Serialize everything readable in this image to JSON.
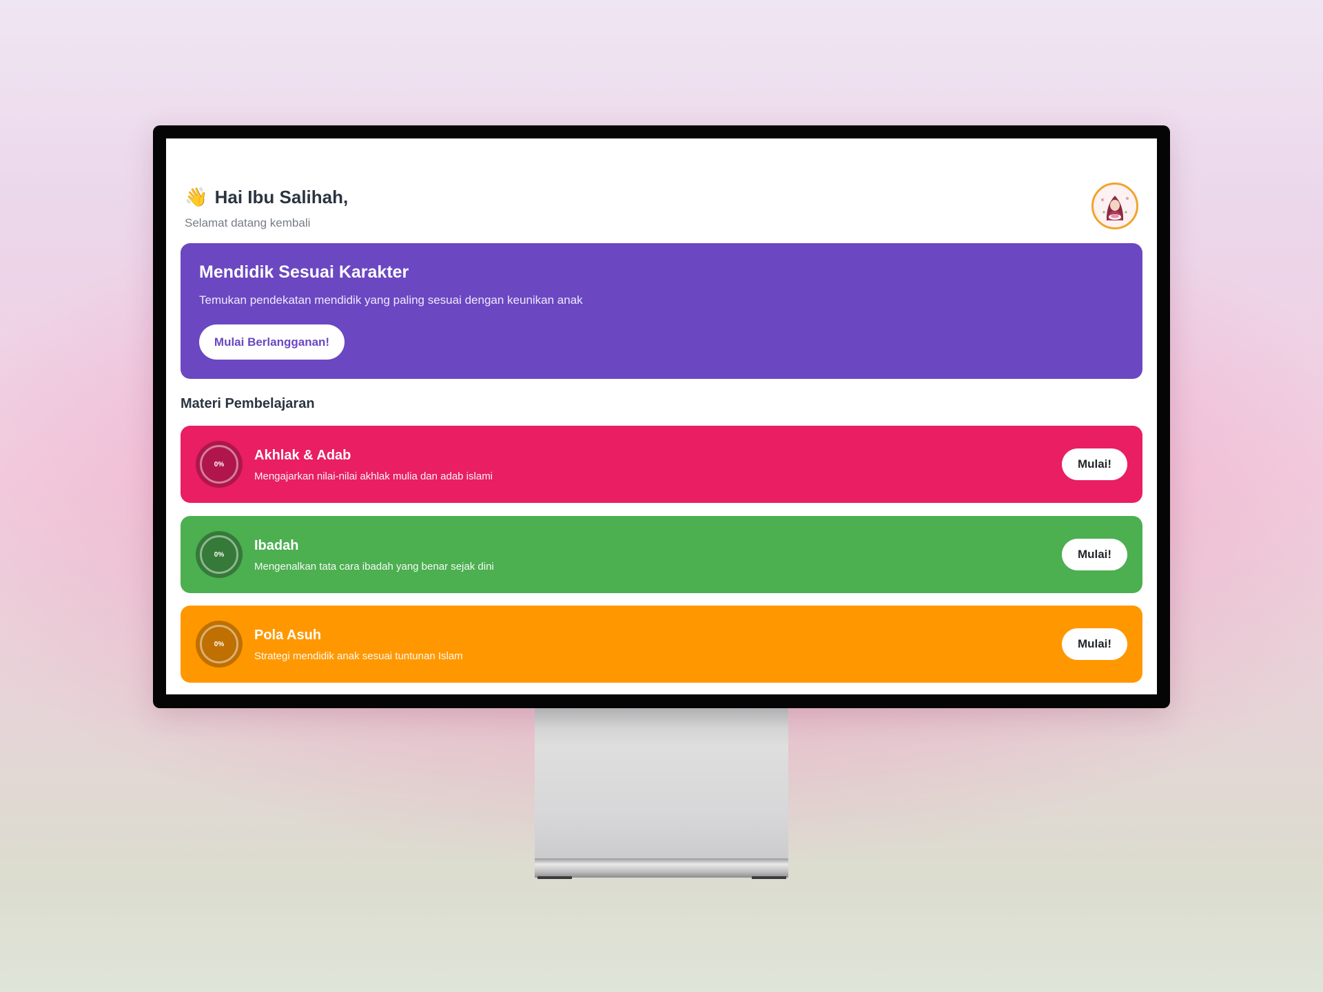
{
  "header": {
    "wave_emoji": "👋",
    "greeting": "Hai Ibu Salihah,",
    "subtitle": "Selamat datang kembali"
  },
  "banner": {
    "title": "Mendidik Sesuai Karakter",
    "description": "Temukan pendekatan mendidik yang paling sesuai dengan keunikan anak",
    "cta_label": "Mulai Berlangganan!"
  },
  "section_title": "Materi Pembelajaran",
  "courses": [
    {
      "title": "Akhlak & Adab",
      "description": "Mengajarkan nilai-nilai akhlak mulia dan adab islami",
      "progress": "0%",
      "button": "Mulai!",
      "color": "#e91e63",
      "ring_color": "#b0164b"
    },
    {
      "title": "Ibadah",
      "description": "Mengenalkan tata cara ibadah yang benar sejak dini",
      "progress": "0%",
      "button": "Mulai!",
      "color": "#4caf50",
      "ring_color": "#357a38"
    },
    {
      "title": "Pola Asuh",
      "description": "Strategi mendidik anak sesuai tuntunan Islam",
      "progress": "0%",
      "button": "Mulai!",
      "color": "#ff9800",
      "ring_color": "#bf7000"
    }
  ],
  "colors": {
    "banner": "#6b47c1",
    "avatar_border": "#f1a32a",
    "text_dark": "#2b3441"
  }
}
